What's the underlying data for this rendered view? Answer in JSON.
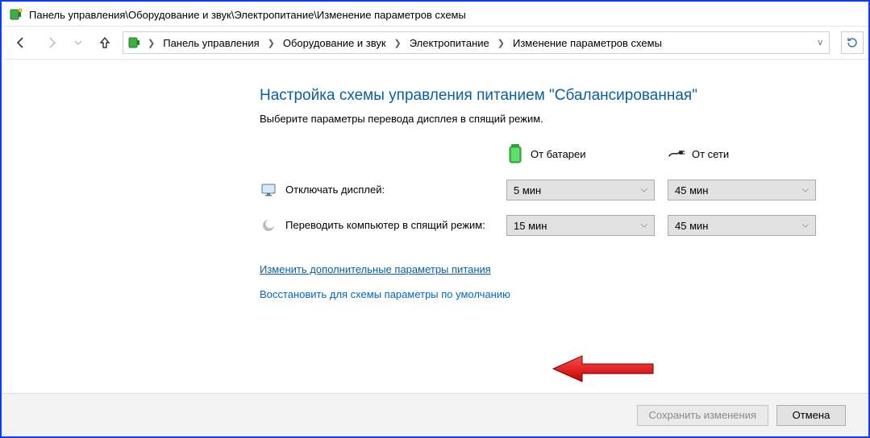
{
  "window": {
    "title_path": "Панель управления\\Оборудование и звук\\Электропитание\\Изменение параметров схемы"
  },
  "breadcrumb": {
    "items": [
      "Панель управления",
      "Оборудование и звук",
      "Электропитание",
      "Изменение параметров схемы"
    ]
  },
  "main": {
    "heading": "Настройка схемы управления питанием \"Сбалансированная\"",
    "subtext": "Выберите параметры перевода дисплея в спящий режим.",
    "columns": {
      "battery": "От батареи",
      "plugged": "От сети"
    },
    "rows": [
      {
        "label": "Отключать дисплей:",
        "battery_value": "5 мин",
        "plugged_value": "45 мин"
      },
      {
        "label": "Переводить компьютер в спящий режим:",
        "battery_value": "15 мин",
        "plugged_value": "45 мин"
      }
    ],
    "link_advanced": "Изменить дополнительные параметры питания",
    "link_restore": "Восстановить для схемы параметры по умолчанию"
  },
  "footer": {
    "save": "Сохранить изменения",
    "cancel": "Отмена"
  }
}
